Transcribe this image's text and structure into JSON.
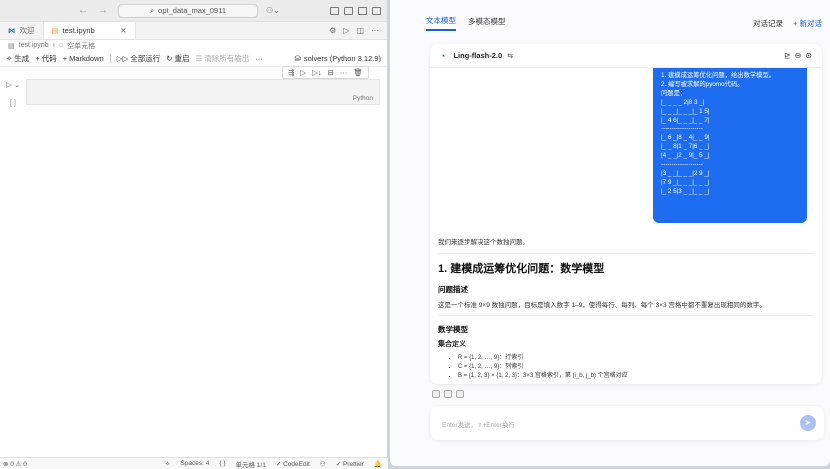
{
  "vscode": {
    "command_center": "opt_data_max_0911",
    "tabs": [
      {
        "label": "欢迎"
      },
      {
        "label": "test.ipynb"
      }
    ],
    "breadcrumb": [
      "test.ipynb",
      "空单元格"
    ],
    "toolbar": {
      "generate": "生成",
      "code": "代码",
      "markdown": "Markdown",
      "run_all": "全部运行",
      "restart": "重启",
      "clear_outputs": "清除所有输出",
      "more": "···",
      "kernel": "solvers (Python 3.12.9)"
    },
    "cell": {
      "exec_marker": "[ ]",
      "language": "Python"
    },
    "statusbar": {
      "left": "⊗ 0 ⚠ 0",
      "spaces": "Spaces: 4",
      "cell_pos": "单元格 1/1",
      "codeedit": "CodeEdit",
      "prettier": "Prettier"
    }
  },
  "chat": {
    "mode_tabs": [
      "文本模型",
      "多模态模型"
    ],
    "history": "对话记录",
    "new_chat": "+ 新对话",
    "model_name": "Ling-flash-2.0",
    "user_message_lines": [
      "1. 建模成运筹优化问题，给出数学模型。",
      "2. 编写被求解的pyomo代码。",
      "问题是：",
      "|_ _ _ _ 2|8 3 _|",
      "|_ _ _|_ _ _|_ 1 5|",
      "|_ 4 6|_ _ _|_ _ 7|",
      "--------------------",
      "|_ 6 _|8 _ 4|_ _ 9|",
      "|_ _ 8|1 _ 7|6 _ _|",
      "|4 _ _|2 _ 9|_ 5 _|",
      "--------------------",
      "|3 _ _|_ _ _|2 9 _|",
      "|7 9 _|_ _ _|_ _ _|",
      "|_ 2 5|3 _ _|_ _ _|"
    ],
    "answer": {
      "intro": "我们来逐步解决这个数独问题。",
      "h1": "1. 建模成运筹优化问题：数学模型",
      "h2_problem": "问题描述",
      "problem_text": "这是一个标准 9×9 数独问题，目标是填入数字 1–9，使得每行、每列、每个 3×3 宫格中都不重复出现相同的数字。",
      "h2_model": "数学模型",
      "h3_sets": "集合定义",
      "sets": [
        "R = {1, 2, …, 9}：行索引",
        "C = {1, 2, …, 9}：列索引",
        "B = {1, 2, 3} × {1, 2, 3}：3×3 宫格索引，第 (i_b, j_b) 个宫格对应"
      ]
    },
    "input_placeholder": "Enter发送，⇧+Enter换行"
  }
}
